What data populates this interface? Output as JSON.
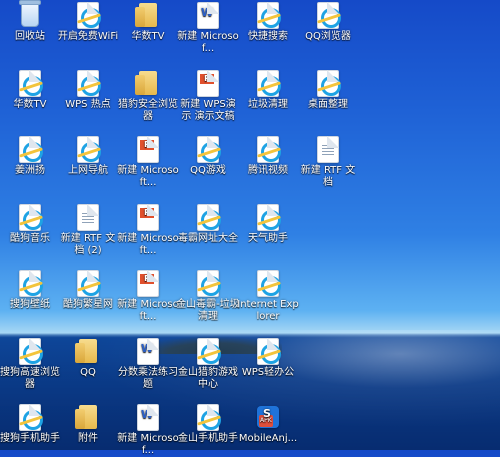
{
  "desktop": {
    "icons": [
      {
        "label": "回收站",
        "type": "recycle-bin"
      },
      {
        "label": "开启免费WiFi",
        "type": "ie"
      },
      {
        "label": "华数TV",
        "type": "folder"
      },
      {
        "label": "新建 Microsof...",
        "type": "wps-doc"
      },
      {
        "label": "快捷搜索",
        "type": "ie"
      },
      {
        "label": "QQ浏览器",
        "type": "ie"
      },
      {
        "label": "华数TV",
        "type": "ie"
      },
      {
        "label": "WPS 热点",
        "type": "ie"
      },
      {
        "label": "猎豹安全浏览器",
        "type": "folder"
      },
      {
        "label": "新建 WPS演示 演示文稿",
        "type": "wps-ppt"
      },
      {
        "label": "垃圾清理",
        "type": "ie"
      },
      {
        "label": "桌面整理",
        "type": "ie"
      },
      {
        "label": "姜洲扬",
        "type": "ie"
      },
      {
        "label": "上网导航",
        "type": "ie"
      },
      {
        "label": "新建 Microsoft...",
        "type": "wps-ppt"
      },
      {
        "label": "QQ游戏",
        "type": "ie"
      },
      {
        "label": "腾讯视频",
        "type": "ie"
      },
      {
        "label": "新建 RTF 文档",
        "type": "rtf"
      },
      {
        "label": "酷狗音乐",
        "type": "ie"
      },
      {
        "label": "新建 RTF 文档 (2)",
        "type": "rtf"
      },
      {
        "label": "新建 Microsoft...",
        "type": "wps-ppt"
      },
      {
        "label": "毒霸网址大全",
        "type": "ie"
      },
      {
        "label": "天气助手",
        "type": "ie"
      },
      {
        "label": "搜狗壁纸",
        "type": "ie"
      },
      {
        "label": "酷狗繁星网",
        "type": "ie"
      },
      {
        "label": "新建 Microsoft...",
        "type": "wps-ppt"
      },
      {
        "label": "金山毒霸-垃圾清理",
        "type": "ie"
      },
      {
        "label": "Internet Explorer",
        "type": "ie"
      },
      {
        "label": "搜狗高速浏览器",
        "type": "ie"
      },
      {
        "label": "QQ",
        "type": "folder"
      },
      {
        "label": "分数乘法练习题",
        "type": "wps-doc"
      },
      {
        "label": "金山猎豹游戏中心",
        "type": "ie"
      },
      {
        "label": "WPS轻办公",
        "type": "ie"
      },
      {
        "label": "搜狗手机助手",
        "type": "ie"
      },
      {
        "label": "附件",
        "type": "folder"
      },
      {
        "label": "新建 Microsof...",
        "type": "wps-doc"
      },
      {
        "label": "金山手机助手",
        "type": "ie"
      },
      {
        "label": "MobileAnj...",
        "type": "apk"
      }
    ]
  }
}
